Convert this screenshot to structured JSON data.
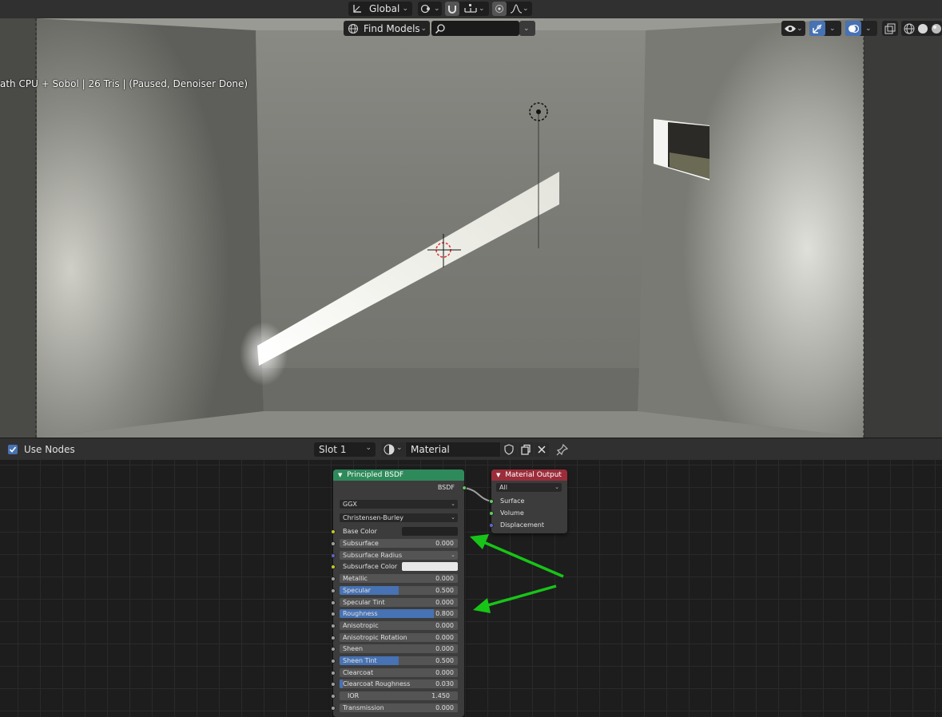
{
  "header": {
    "transform_orientation": "Global",
    "find_models": "Find Models",
    "search_placeholder": ""
  },
  "viewport": {
    "render_info": "ath CPU + Sobol | 26 Tris | (Paused, Denoiser Done)"
  },
  "node_header": {
    "use_nodes_label": "Use Nodes",
    "use_nodes_checked": true,
    "slot": "Slot 1",
    "material_name": "Material"
  },
  "principled_bsdf": {
    "title": "Principled BSDF",
    "output_label": "BSDF",
    "distribution": "GGX",
    "subsurface_method": "Christensen-Burley",
    "base_color_label": "Base Color",
    "base_color": "#222222",
    "subsurface_color_label": "Subsurface Color",
    "subsurface_color": "#e8e8e8",
    "subsurface_radius_label": "Subsurface Radius",
    "inputs": [
      {
        "label": "Subsurface",
        "value": "0.000",
        "fill": 0
      },
      {
        "label": "Metallic",
        "value": "0.000",
        "fill": 0
      },
      {
        "label": "Specular",
        "value": "0.500",
        "fill": 0.5
      },
      {
        "label": "Specular Tint",
        "value": "0.000",
        "fill": 0
      },
      {
        "label": "Roughness",
        "value": "0.800",
        "fill": 0.8
      },
      {
        "label": "Anisotropic",
        "value": "0.000",
        "fill": 0
      },
      {
        "label": "Anisotropic Rotation",
        "value": "0.000",
        "fill": 0
      },
      {
        "label": "Sheen",
        "value": "0.000",
        "fill": 0
      },
      {
        "label": "Sheen Tint",
        "value": "0.500",
        "fill": 0.5
      },
      {
        "label": "Clearcoat",
        "value": "0.000",
        "fill": 0
      },
      {
        "label": "Clearcoat Roughness",
        "value": "0.030",
        "fill": 0.03
      },
      {
        "label": "IOR",
        "value": "1.450",
        "fill": 0
      },
      {
        "label": "Transmission",
        "value": "0.000",
        "fill": 0
      }
    ]
  },
  "material_output": {
    "title": "Material Output",
    "target": "All",
    "sockets": [
      "Surface",
      "Volume",
      "Displacement"
    ]
  },
  "colors": {
    "bsdf_header": "#2e8a5a",
    "output_header": "#9b2d3a",
    "annotation_arrow": "#18c418",
    "slider_fill": "#4772b3"
  }
}
